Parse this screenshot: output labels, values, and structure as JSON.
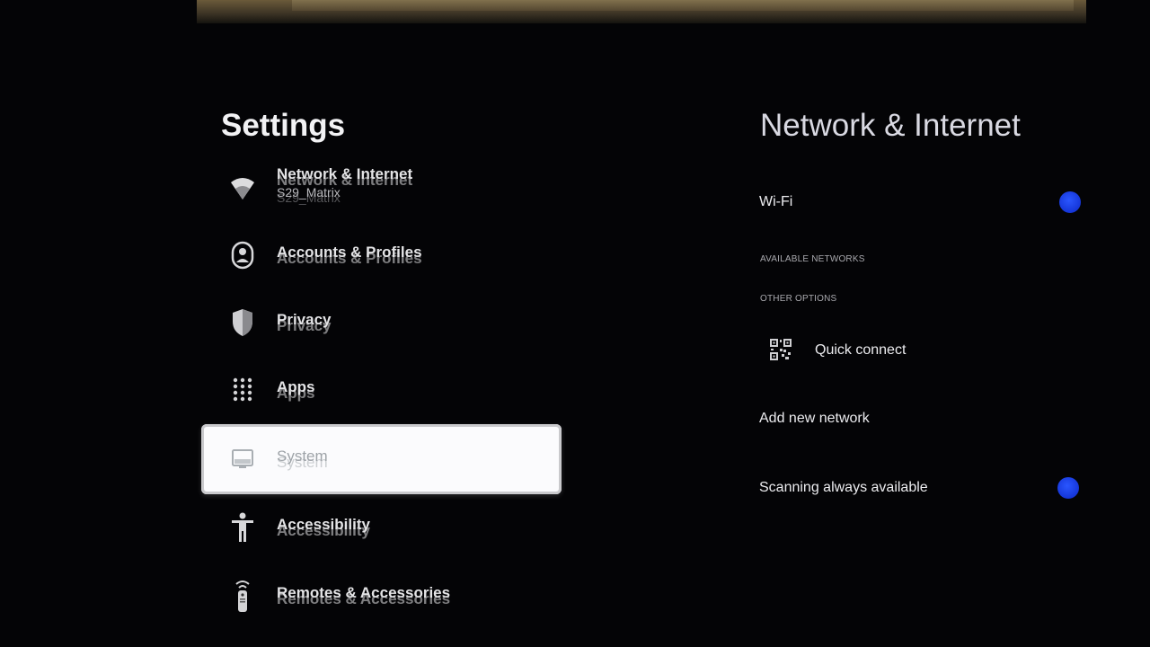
{
  "left_panel": {
    "title": "Settings",
    "items": [
      {
        "label": "Network & Internet",
        "sublabel": "S29_Matrix",
        "icon": "wifi-icon"
      },
      {
        "label": "Accounts & Profiles",
        "icon": "account-icon"
      },
      {
        "label": "Privacy",
        "icon": "shield-icon"
      },
      {
        "label": "Apps",
        "icon": "apps-grid-icon"
      },
      {
        "label": "System",
        "icon": "monitor-icon",
        "selected": true
      },
      {
        "label": "Accessibility",
        "icon": "accessibility-icon"
      },
      {
        "label": "Remotes & Accessories",
        "icon": "remote-icon"
      }
    ]
  },
  "right_panel": {
    "title": "Network & Internet",
    "wifi_label": "Wi-Fi",
    "wifi_enabled": true,
    "available_networks_header": "AVAILABLE NETWORKS",
    "other_options_header": "OTHER OPTIONS",
    "quick_connect_label": "Quick connect",
    "quick_connect_icon": "qr-code-icon",
    "add_network_label": "Add new network",
    "scanning_label": "Scanning always available",
    "scanning_enabled": true
  },
  "colors": {
    "background": "#040406",
    "toggle_on": "#1c3ef0",
    "selected_item_bg": "#fbfbfd"
  }
}
